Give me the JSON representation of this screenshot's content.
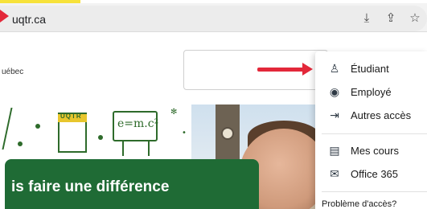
{
  "browser": {
    "url": "uqtr.ca",
    "icons": [
      "download-icon",
      "share-icon",
      "star-icon"
    ],
    "accent_color": "#e3283a"
  },
  "site": {
    "region_text": "uébec",
    "hero_heading": "is faire une différence",
    "chalk_board_text": "e=m.c²",
    "logo_text": "UQTR",
    "brand_color": "#1f6b35"
  },
  "menu": {
    "items": [
      {
        "label": "Étudiant",
        "icon": "student-icon"
      },
      {
        "label": "Employé",
        "icon": "employee-icon"
      },
      {
        "label": "Autres accès",
        "icon": "login-icon"
      },
      {
        "label": "Mes cours",
        "icon": "courses-icon"
      },
      {
        "label": "Office 365",
        "icon": "mail-icon"
      }
    ],
    "footer": "Problème d'accès?"
  }
}
